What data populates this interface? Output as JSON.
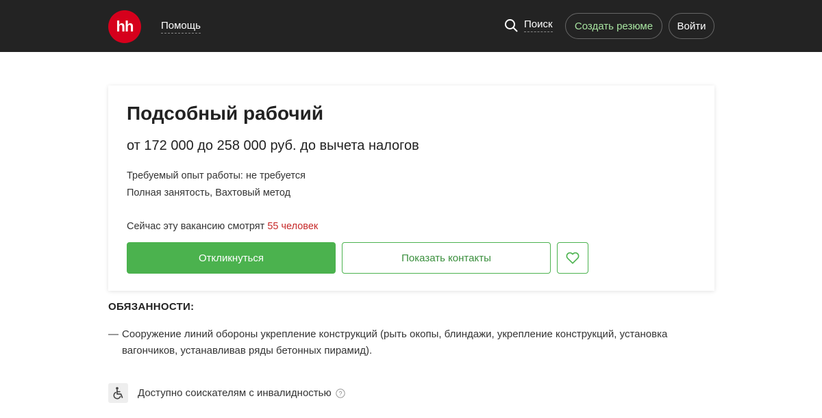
{
  "header": {
    "logo_text": "hh",
    "help_label": "Помощь",
    "search_label": "Поиск",
    "create_resume_label": "Создать резюме",
    "login_label": "Войти"
  },
  "vacancy": {
    "title": "Подсобный рабочий",
    "salary": "от 172 000 до 258 000 руб. до вычета налогов",
    "experience": "Требуемый опыт работы: не требуется",
    "employment": "Полная занятость, Вахтовый метод",
    "viewers_prefix": "Сейчас эту вакансию смотрят ",
    "viewers_count": "55 человек",
    "respond_label": "Откликнуться",
    "contacts_label": "Показать контакты"
  },
  "description": {
    "section_title": "ОБЯЗАННОСТИ:",
    "dash": "—",
    "duty_text": "Сооружение линий обороны укрепление конструкций (рыть окопы, блиндажи, укрепление конструкций, установка вагончиков, устанавливав ряды бетонных пирамид).",
    "accessibility_label": "Доступно соискателям с инвалидностью"
  },
  "colors": {
    "header_bg": "#232323",
    "logo_red": "#d6001c",
    "accent_green": "#4bb24e",
    "viewers_red": "#c62828"
  }
}
